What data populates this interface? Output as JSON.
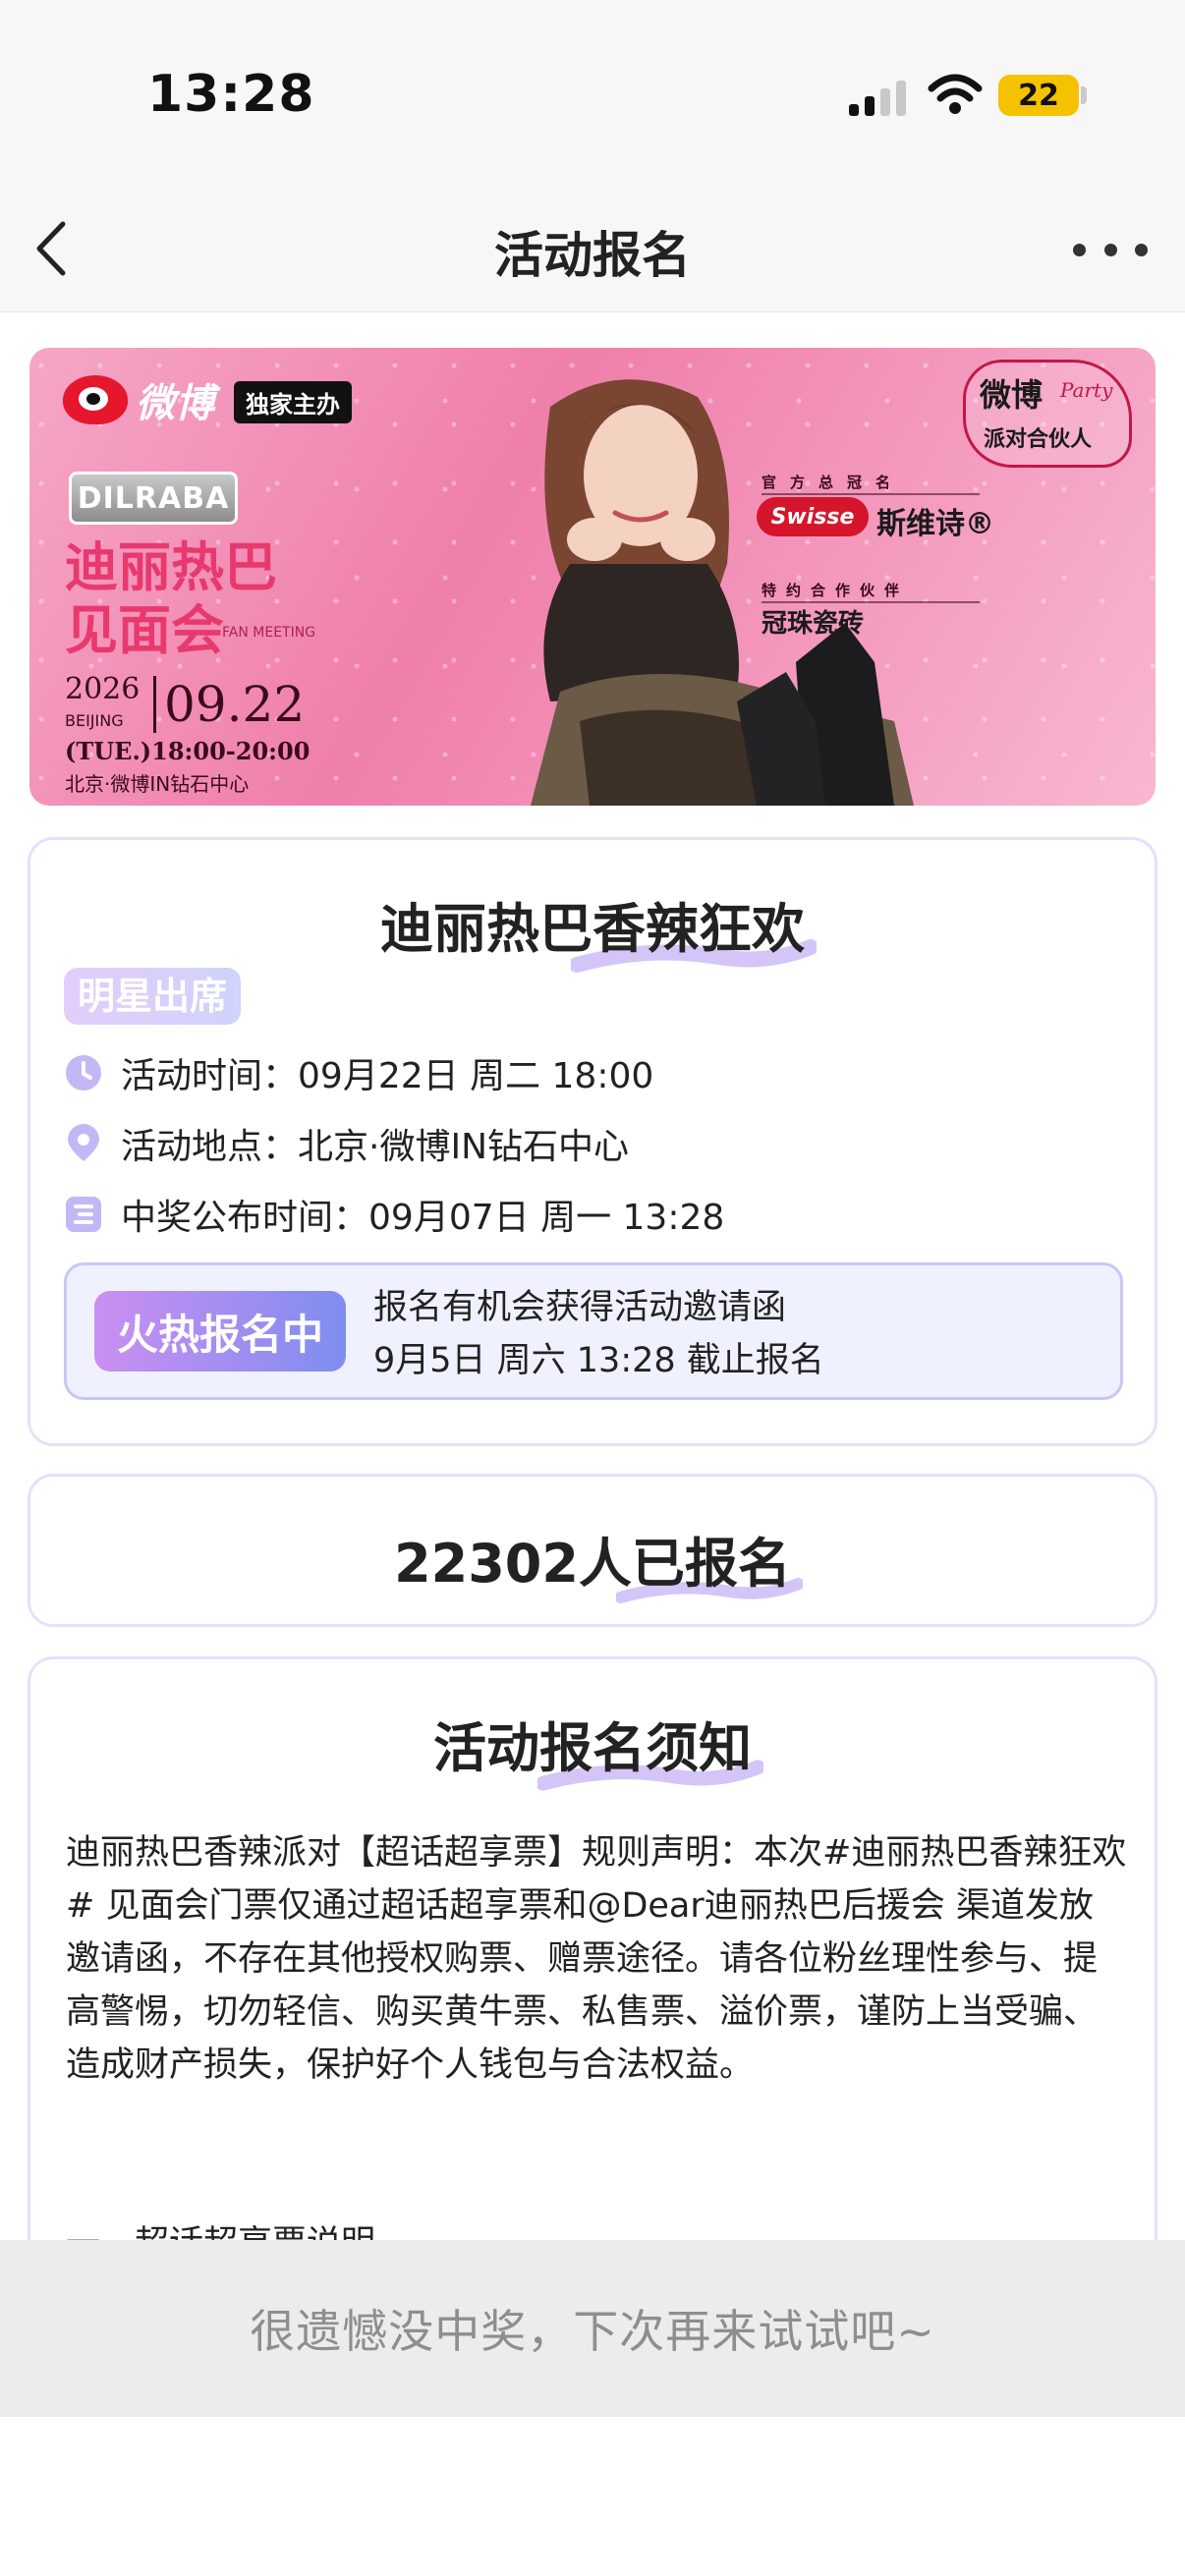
{
  "status_bar": {
    "time": "13:28",
    "battery": "22"
  },
  "nav": {
    "title": "活动报名",
    "back_icon": "chevron-left-icon",
    "more_icon": "more-dots-icon"
  },
  "banner": {
    "weibo_text": "微博",
    "exclusive": "独家主办",
    "artist_badge": "DILRABA",
    "title": "迪丽热巴见面会",
    "fan_meeting": "FAN MEETING",
    "year": "2026",
    "city": "BEIJING",
    "day": "09.22",
    "time_slot": "(TUE.)18:00-20:00",
    "venue": "北京·微博IN钻石中心",
    "party_title": "微博",
    "party_sub": "派对合伙人",
    "party_script": "Party",
    "title_sponsor_label": "官方总冠名",
    "sponsor_brand": "Swisse",
    "sponsor_cn": "斯维诗®",
    "partner_label": "特约合作伙伴",
    "partner_name": "冠珠瓷砖"
  },
  "info_card": {
    "title": "迪丽热巴香辣狂欢",
    "star_badge": "明星出席",
    "event_time_label": "活动时间：",
    "event_time": "09月22日 周二 18:00",
    "location_label": "活动地点：",
    "location": "北京·微博IN钻石中心",
    "announce_label": "中奖公布时间：",
    "announce_time": "09月07日 周一 13:28",
    "hot_badge": "火热报名中",
    "signup_line1": "报名有机会获得活动邀请函",
    "signup_line2": "9月5日 周六 13:28 截止报名"
  },
  "count_card": {
    "text": "22302人已报名"
  },
  "notice_card": {
    "title": "活动报名须知",
    "body": "迪丽热巴香辣派对【超话超享票】规则声明：本次#迪丽热巴香辣狂欢# 见面会门票仅通过超话超享票和@Dear迪丽热巴后援会 渠道发放邀请函，不存在其他授权购票、赠票途径。请各位粉丝理性参与、提高警惕，切勿轻信、购买黄牛票、私售票、溢价票，谨防上当受骗、造成财产损失，保护好个人钱包与合法权益。",
    "partial": "一、超话超享票说明"
  },
  "result": {
    "text": "很遗憾没中奖，下次再来试试吧~"
  },
  "colors": {
    "accent_purple": "#8f8df0",
    "card_border": "#e1e3fb",
    "banner_pink": "#ef7fab",
    "weibo_red": "#e6162d"
  }
}
